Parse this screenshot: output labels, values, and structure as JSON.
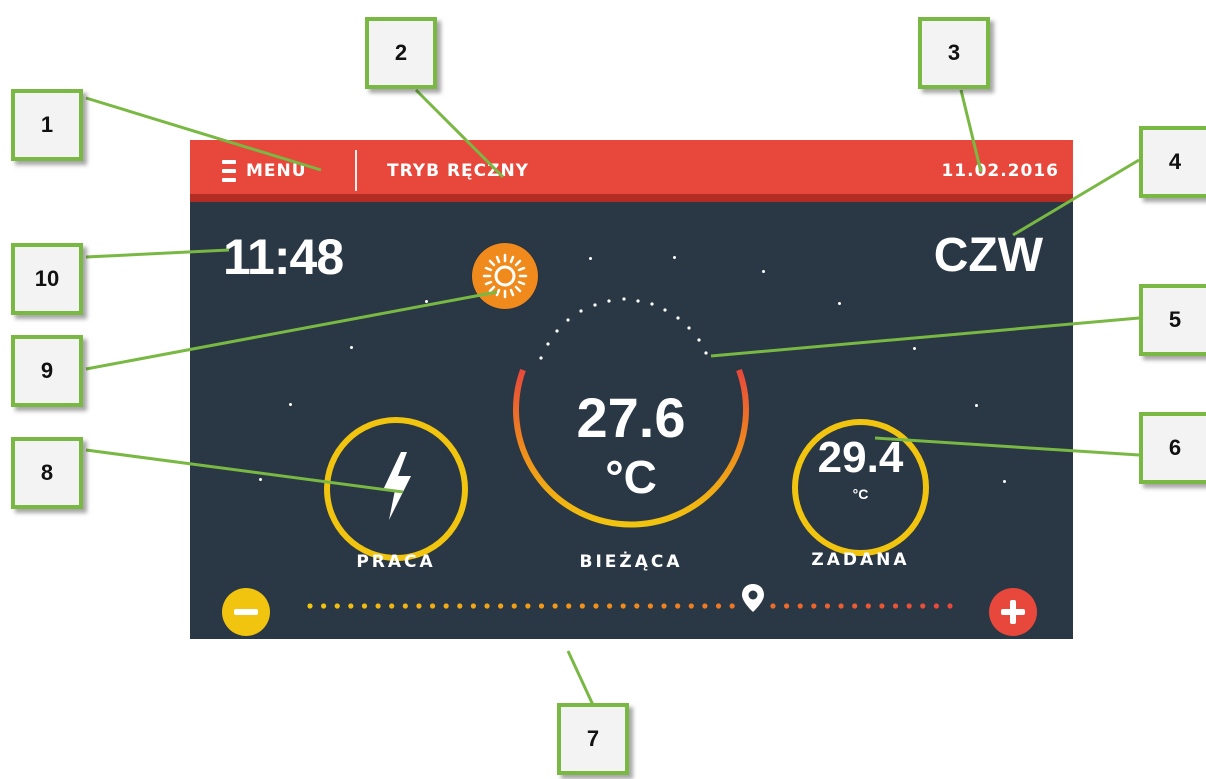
{
  "topbar": {
    "menu_label": "MENU",
    "mode_label": "TRYB RĘCZNY",
    "date": "11.02.2016"
  },
  "clock": {
    "time": "11:48",
    "day": "CZW"
  },
  "work": {
    "label": "PRACA",
    "icon": "lightning-bolt-icon"
  },
  "current": {
    "value": "27.6",
    "unit": "°C",
    "label": "BIEŻĄCA"
  },
  "setpoint": {
    "value": "29.4",
    "unit": "°C",
    "label": "ZADANA"
  },
  "mode_icon": "sun-icon",
  "callouts": {
    "c1": "1",
    "c2": "2",
    "c3": "3",
    "c4": "4",
    "c5": "5",
    "c6": "6",
    "c7": "7",
    "c8": "8",
    "c9": "9",
    "c10": "10"
  },
  "colors": {
    "topbar": "#e8483b",
    "background": "#2a3745",
    "accent_yellow": "#f1c40f",
    "accent_orange": "#f08a1c",
    "accent_red": "#e8483b",
    "callout_border": "#78b843"
  }
}
